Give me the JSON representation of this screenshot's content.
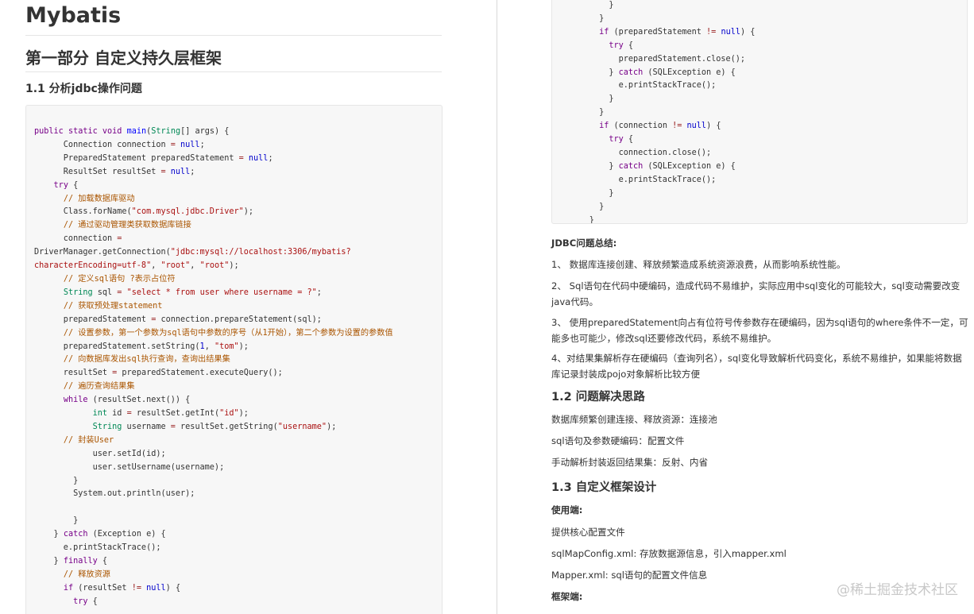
{
  "doc": {
    "title": "Mybatis",
    "part_title": "第一部分 自定义持久层框架",
    "section_1_1": "1.1 分析jdbc操作问题",
    "code_left": [
      [
        [
          "kw",
          "public"
        ],
        [
          "",
          " "
        ],
        [
          "kw",
          "static"
        ],
        [
          "",
          " "
        ],
        [
          "kw",
          "void"
        ],
        [
          "",
          " "
        ],
        [
          "fn",
          "main"
        ],
        [
          "",
          "("
        ],
        [
          "ty",
          "String"
        ],
        [
          "",
          "[] args) {"
        ]
      ],
      [
        [
          "",
          "      Connection connection "
        ],
        [
          "op",
          "="
        ],
        [
          "",
          " "
        ],
        [
          "at",
          "null"
        ],
        [
          "",
          ";"
        ]
      ],
      [
        [
          "",
          "      PreparedStatement preparedStatement "
        ],
        [
          "op",
          "="
        ],
        [
          "",
          " "
        ],
        [
          "at",
          "null"
        ],
        [
          "",
          ";"
        ]
      ],
      [
        [
          "",
          "      ResultSet resultSet "
        ],
        [
          "op",
          "="
        ],
        [
          "",
          " "
        ],
        [
          "at",
          "null"
        ],
        [
          "",
          ";"
        ]
      ],
      [
        [
          "",
          "    "
        ],
        [
          "kw",
          "try"
        ],
        [
          "",
          " {"
        ]
      ],
      [
        [
          "",
          "      "
        ],
        [
          "cm",
          "// 加载数据库驱动"
        ]
      ],
      [
        [
          "",
          "      Class.forName("
        ],
        [
          "st",
          "\"com.mysql.jdbc.Driver\""
        ],
        [
          "",
          ");"
        ]
      ],
      [
        [
          "",
          "      "
        ],
        [
          "cm",
          "// 通过驱动管理类获取数据库链接"
        ]
      ],
      [
        [
          "",
          "      connection "
        ],
        [
          "op",
          "="
        ]
      ],
      [
        [
          "",
          "DriverManager.getConnection("
        ],
        [
          "st",
          "\"jdbc:mysql://localhost:3306/mybatis?"
        ]
      ],
      [
        [
          "st",
          "characterEncoding=utf-8\""
        ],
        [
          "",
          ", "
        ],
        [
          "st",
          "\"root\""
        ],
        [
          "",
          ", "
        ],
        [
          "st",
          "\"root\""
        ],
        [
          "",
          ");"
        ]
      ],
      [
        [
          "",
          "      "
        ],
        [
          "cm",
          "// 定义sql语句 ?表示占位符"
        ]
      ],
      [
        [
          "",
          "      "
        ],
        [
          "ty",
          "String"
        ],
        [
          "",
          " sql "
        ],
        [
          "op",
          "="
        ],
        [
          "",
          " "
        ],
        [
          "st",
          "\"select * from user where username = ?\""
        ],
        [
          "",
          ";"
        ]
      ],
      [
        [
          "",
          "      "
        ],
        [
          "cm",
          "// 获取预处理statement"
        ]
      ],
      [
        [
          "",
          "      preparedStatement "
        ],
        [
          "op",
          "="
        ],
        [
          "",
          " connection.prepareStatement(sql);"
        ]
      ],
      [
        [
          "",
          "      "
        ],
        [
          "cm",
          "// 设置参数，第一个参数为sql语句中参数的序号（从1开始），第二个参数为设置的参数值"
        ]
      ],
      [
        [
          "",
          "      preparedStatement.setString("
        ],
        [
          "at",
          "1"
        ],
        [
          "",
          ", "
        ],
        [
          "st",
          "\"tom\""
        ],
        [
          "",
          ");"
        ]
      ],
      [
        [
          "",
          "      "
        ],
        [
          "cm",
          "// 向数据库发出sql执行查询，查询出结果集"
        ]
      ],
      [
        [
          "",
          "      resultSet "
        ],
        [
          "op",
          "="
        ],
        [
          "",
          " preparedStatement.executeQuery();"
        ]
      ],
      [
        [
          "",
          "      "
        ],
        [
          "cm",
          "// 遍历查询结果集"
        ]
      ],
      [
        [
          "",
          "      "
        ],
        [
          "kw",
          "while"
        ],
        [
          "",
          " (resultSet.next()) {"
        ]
      ],
      [
        [
          "",
          "            "
        ],
        [
          "ty",
          "int"
        ],
        [
          "",
          " id "
        ],
        [
          "op",
          "="
        ],
        [
          "",
          " resultSet.getInt("
        ],
        [
          "st",
          "\"id\""
        ],
        [
          "",
          ");"
        ]
      ],
      [
        [
          "",
          "            "
        ],
        [
          "ty",
          "String"
        ],
        [
          "",
          " username "
        ],
        [
          "op",
          "="
        ],
        [
          "",
          " resultSet.getString("
        ],
        [
          "st",
          "\"username\""
        ],
        [
          "",
          ");"
        ]
      ],
      [
        [
          "",
          "      "
        ],
        [
          "cm",
          "// 封装User"
        ]
      ],
      [
        [
          "",
          "            user.setId(id);"
        ]
      ],
      [
        [
          "",
          "            user.setUsername(username);"
        ]
      ],
      [
        [
          "",
          "        }"
        ]
      ],
      [
        [
          "",
          "        System.out.println(user);"
        ]
      ],
      [
        [
          "",
          ""
        ]
      ],
      [
        [
          "",
          "        }"
        ]
      ],
      [
        [
          "",
          "    } "
        ],
        [
          "kw",
          "catch"
        ],
        [
          "",
          " (Exception e) {"
        ]
      ],
      [
        [
          "",
          "      e.printStackTrace();"
        ]
      ],
      [
        [
          "",
          "    } "
        ],
        [
          "kw",
          "finally"
        ],
        [
          "",
          " {"
        ]
      ],
      [
        [
          "",
          "      "
        ],
        [
          "cm",
          "// 释放资源"
        ]
      ],
      [
        [
          "",
          "      "
        ],
        [
          "kw",
          "if"
        ],
        [
          "",
          " (resultSet "
        ],
        [
          "op",
          "!="
        ],
        [
          "",
          " "
        ],
        [
          "at",
          "null"
        ],
        [
          "",
          ") {"
        ]
      ],
      [
        [
          "",
          "        "
        ],
        [
          "kw",
          "try"
        ],
        [
          "",
          " {"
        ]
      ]
    ],
    "code_right": [
      [
        [
          "",
          "          }"
        ]
      ],
      [
        [
          "",
          "        }"
        ]
      ],
      [
        [
          "",
          "        "
        ],
        [
          "kw",
          "if"
        ],
        [
          "",
          " (preparedStatement "
        ],
        [
          "op",
          "!="
        ],
        [
          "",
          " "
        ],
        [
          "at",
          "null"
        ],
        [
          "",
          ") {"
        ]
      ],
      [
        [
          "",
          "          "
        ],
        [
          "kw",
          "try"
        ],
        [
          "",
          " {"
        ]
      ],
      [
        [
          "",
          "            preparedStatement.close();"
        ]
      ],
      [
        [
          "",
          "          } "
        ],
        [
          "kw",
          "catch"
        ],
        [
          "",
          " (SQLException e) {"
        ]
      ],
      [
        [
          "",
          "            e.printStackTrace();"
        ]
      ],
      [
        [
          "",
          "          }"
        ]
      ],
      [
        [
          "",
          "        }"
        ]
      ],
      [
        [
          "",
          "        "
        ],
        [
          "kw",
          "if"
        ],
        [
          "",
          " (connection "
        ],
        [
          "op",
          "!="
        ],
        [
          "",
          " "
        ],
        [
          "at",
          "null"
        ],
        [
          "",
          ") {"
        ]
      ],
      [
        [
          "",
          "          "
        ],
        [
          "kw",
          "try"
        ],
        [
          "",
          " {"
        ]
      ],
      [
        [
          "",
          "            connection.close();"
        ]
      ],
      [
        [
          "",
          "          } "
        ],
        [
          "kw",
          "catch"
        ],
        [
          "",
          " (SQLException e) {"
        ]
      ],
      [
        [
          "",
          "            e.printStackTrace();"
        ]
      ],
      [
        [
          "",
          "          }"
        ]
      ],
      [
        [
          "",
          "        }"
        ]
      ],
      [
        [
          "",
          "      }"
        ]
      ]
    ],
    "summary_title": "JDBC问题总结:",
    "summary_items": [
      "1、 数据库连接创建、释放频繁造成系统资源浪费，从而影响系统性能。",
      "2、 Sql语句在代码中硬编码，造成代码不易维护，实际应用中sql变化的可能较大，sql变动需要改变java代码。",
      "3、 使用preparedStatement向占有位符号传参数存在硬编码，因为sql语句的where条件不一定，可能多也可能少，修改sql还要修改代码，系统不易维护。",
      "4、对结果集解析存在硬编码（查询列名），sql变化导致解析代码变化，系统不易维护，如果能将数据库记录封装成pojo对象解析比较方便"
    ],
    "section_1_2": "1.2 问题解决思路",
    "solutions": [
      "数据库频繁创建连接、释放资源：连接池",
      "sql语句及参数硬编码：配置文件",
      "手动解析封装返回结果集：反射、内省"
    ],
    "section_1_3": "1.3 自定义框架设计",
    "client_label": "使用端:",
    "client_items": [
      "提供核心配置文件",
      "sqlMapConfig.xml: 存放数据源信息，引入mapper.xml",
      "Mapper.xml: sql语句的配置文件信息"
    ],
    "framework_label": "框架端:",
    "watermark": "@稀土掘金技术社区"
  }
}
